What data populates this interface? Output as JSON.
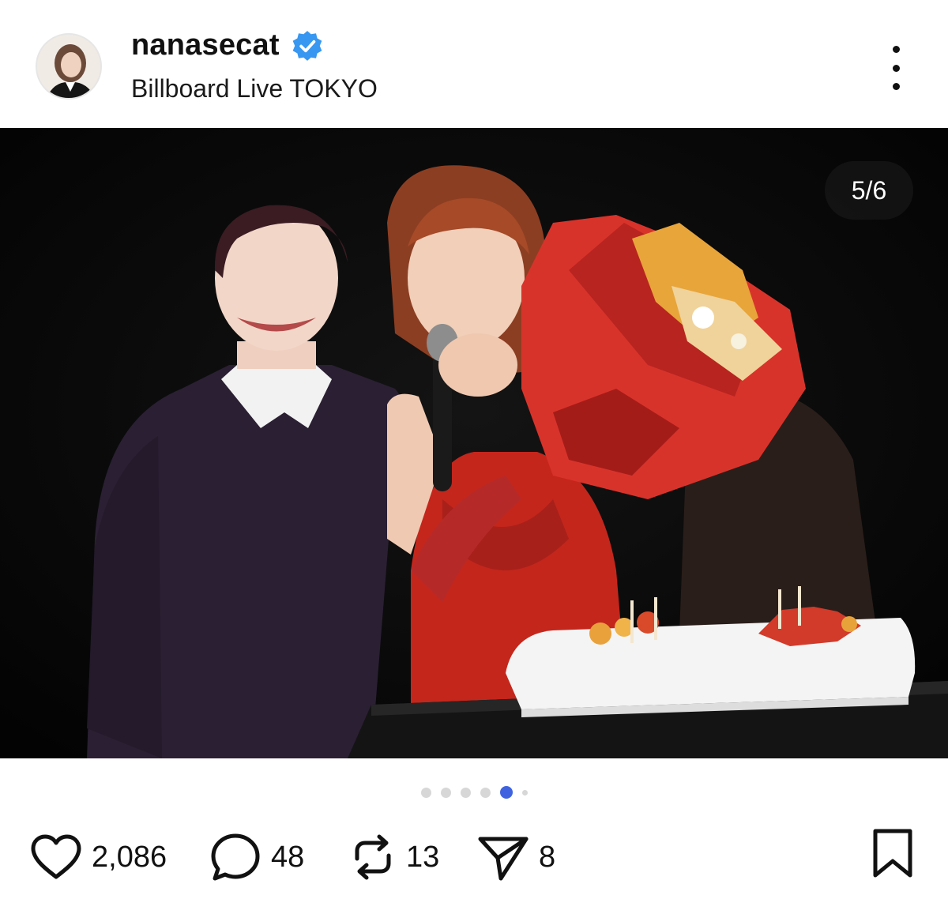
{
  "header": {
    "username": "nanasecat",
    "location": "Billboard Live TOKYO"
  },
  "post": {
    "image_counter": "5/6",
    "carousel": {
      "total": 6,
      "active_index": 5
    }
  },
  "actions": {
    "likes": "2,086",
    "comments": "48",
    "reposts": "13",
    "shares": "8"
  },
  "icons": {
    "verified": "verified-badge-icon",
    "more": "more-options-icon",
    "like": "heart-icon",
    "comment": "comment-bubble-icon",
    "repost": "repost-icon",
    "share": "send-icon",
    "save": "bookmark-icon"
  },
  "colors": {
    "verified_blue": "#3897f0",
    "active_dot": "#3f63e0",
    "inactive_dot": "#d7d7d7"
  }
}
